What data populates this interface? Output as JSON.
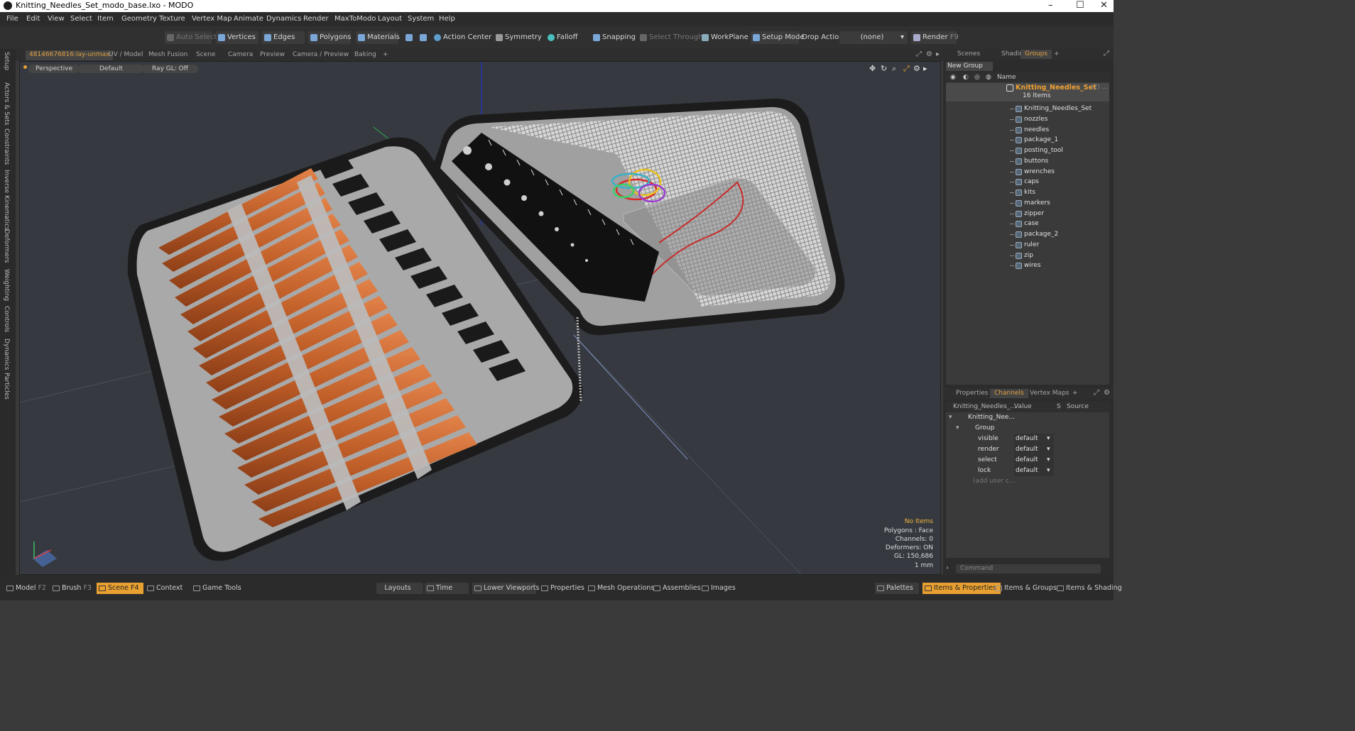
{
  "window": {
    "title": "Knitting_Needles_Set_modo_base.lxo - MODO",
    "min": "–",
    "max": "☐",
    "close": "✕"
  },
  "menu": [
    "File",
    "Edit",
    "View",
    "Select",
    "Item",
    "Geometry",
    "Texture",
    "Vertex Map",
    "Animate",
    "Dynamics",
    "Render",
    "MaxToModo",
    "Layout",
    "System",
    "Help"
  ],
  "toolbar": {
    "auto_select": "Auto Select",
    "vertices": "Vertices",
    "edges": "Edges",
    "polygons": "Polygons",
    "materials": "Materials",
    "action_center": "Action Center",
    "symmetry": "Symmetry",
    "falloff": "Falloff",
    "snapping": "Snapping",
    "select_through": "Select Through",
    "workplane": "WorkPlane",
    "setup_mode": "Setup Mode",
    "drop_action": "Drop Action",
    "none_select": "(none)",
    "render": "Render",
    "render_key": "F9"
  },
  "left_tabs": [
    "Setup",
    "Actors & Sets",
    "Constraints",
    "Inverse Kinematics",
    "Deformers",
    "Weighting",
    "Controls",
    "Dynamics",
    "Particles"
  ],
  "viewport_tabs": [
    {
      "label": "481466768​16:lay-unmax",
      "active": true
    },
    {
      "label": "UV / Model"
    },
    {
      "label": "Mesh Fusion"
    },
    {
      "label": "Scene"
    },
    {
      "label": "Camera"
    },
    {
      "label": "Preview"
    },
    {
      "label": "Camera / Preview"
    },
    {
      "label": "Baking"
    },
    {
      "label": "+"
    }
  ],
  "viewport": {
    "view": "Perspective",
    "shading": "Default",
    "raygl": "Ray GL: Off",
    "info": {
      "items": "No Items",
      "polygons": "Polygons : Face",
      "channels": "Channels: 0",
      "deformers": "Deformers: ON",
      "gl": "GL: 150,686",
      "unit": "1 mm"
    }
  },
  "scene_tabs": [
    {
      "label": "Scenes"
    },
    {
      "label": "Shading"
    },
    {
      "label": "Groups",
      "active": true
    },
    {
      "label": "+"
    }
  ],
  "groups": {
    "new_group": "New Group",
    "name_header": "Name",
    "root": {
      "name": "Knitting_Needles_Set",
      "suffix": "(2) ...",
      "count": "16 Items"
    },
    "items": [
      "Knitting_Needles_Set",
      "nozzles",
      "needles",
      "package_1",
      "posting_tool",
      "buttons",
      "wrenches",
      "caps",
      "kits",
      "markers",
      "zipper",
      "case",
      "package_2",
      "ruler",
      "zip",
      "wires"
    ]
  },
  "prop_tabs": [
    {
      "label": "Properties"
    },
    {
      "label": "Channels",
      "active": true
    },
    {
      "label": "Vertex Maps"
    },
    {
      "label": "+"
    }
  ],
  "channels": {
    "headers": {
      "name": "Knitting_Needles_...",
      "value": "Value",
      "s": "S",
      "source": "Source"
    },
    "item": "Knitting_Nee...",
    "group": "Group",
    "rows": [
      {
        "name": "visible",
        "value": "default"
      },
      {
        "name": "render",
        "value": "default"
      },
      {
        "name": "select",
        "value": "default"
      },
      {
        "name": "lock",
        "value": "default"
      }
    ],
    "add": "(add user c...",
    "command": "Command"
  },
  "bottom": {
    "model": "Model",
    "model_key": "F2",
    "brush": "Brush",
    "brush_key": "F3",
    "scene": "Scene",
    "scene_key": "F4",
    "context": "Context",
    "game_tools": "Game Tools",
    "layouts": "Layouts",
    "time": "Time",
    "lower_viewports": "Lower Viewports",
    "properties": "Properties",
    "mesh_operations": "Mesh Operations",
    "assemblies": "Assemblies",
    "images": "Images",
    "palettes": "Palettes",
    "items_properties": "Items & Properties",
    "items_groups": "Items & Groups",
    "items_shading": "Items & Shading"
  },
  "colors": {
    "accent": "#e8a030",
    "viewport_bg": "#363a40",
    "needle": "#c8682a",
    "cap": "#1a1a1a"
  }
}
